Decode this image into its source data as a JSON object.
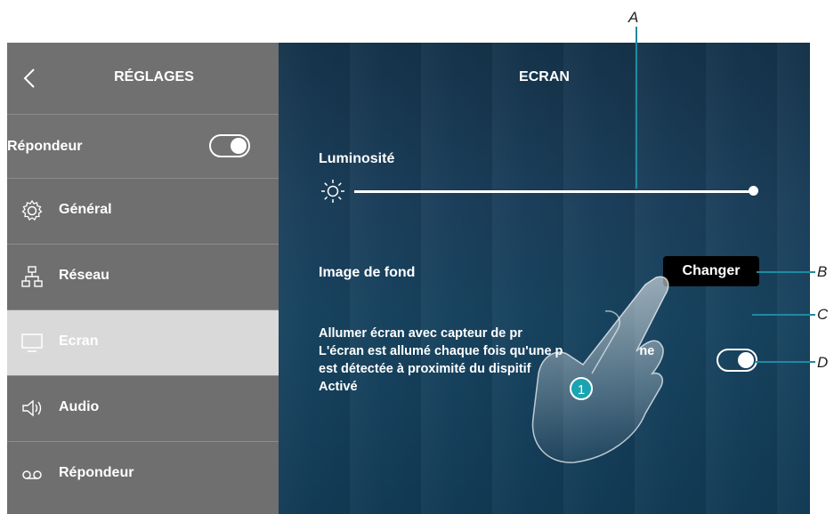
{
  "sidebar": {
    "title": "RÉGLAGES",
    "toggle_row": {
      "label": "Répondeur",
      "enabled": true
    },
    "items": [
      {
        "label": "Général",
        "icon": "gear-icon"
      },
      {
        "label": "Réseau",
        "icon": "network-icon"
      },
      {
        "label": "Ecran",
        "icon": "monitor-icon",
        "active": true
      },
      {
        "label": "Audio",
        "icon": "speaker-icon"
      },
      {
        "label": "Répondeur",
        "icon": "voicemail-icon"
      }
    ]
  },
  "main": {
    "title": "ECRAN",
    "brightness": {
      "label": "Luminosité",
      "value": 1.0
    },
    "background": {
      "label": "Image de fond",
      "button": "Changer"
    },
    "sensor": {
      "line1": "Allumer écran avec capteur de pr",
      "line2": "L'écran est allumé chaque fois qu'une p",
      "line3": "est détectée à proximité du disp",
      "line3b": "ne",
      "line3c": "itif",
      "line4": "Activé",
      "enabled": true
    }
  },
  "annotations": {
    "A": "A",
    "B": "B",
    "C": "C",
    "D": "D",
    "step": "1"
  },
  "colors": {
    "callout": "#1e8aa0",
    "accent_badge": "#1aa3b0"
  }
}
